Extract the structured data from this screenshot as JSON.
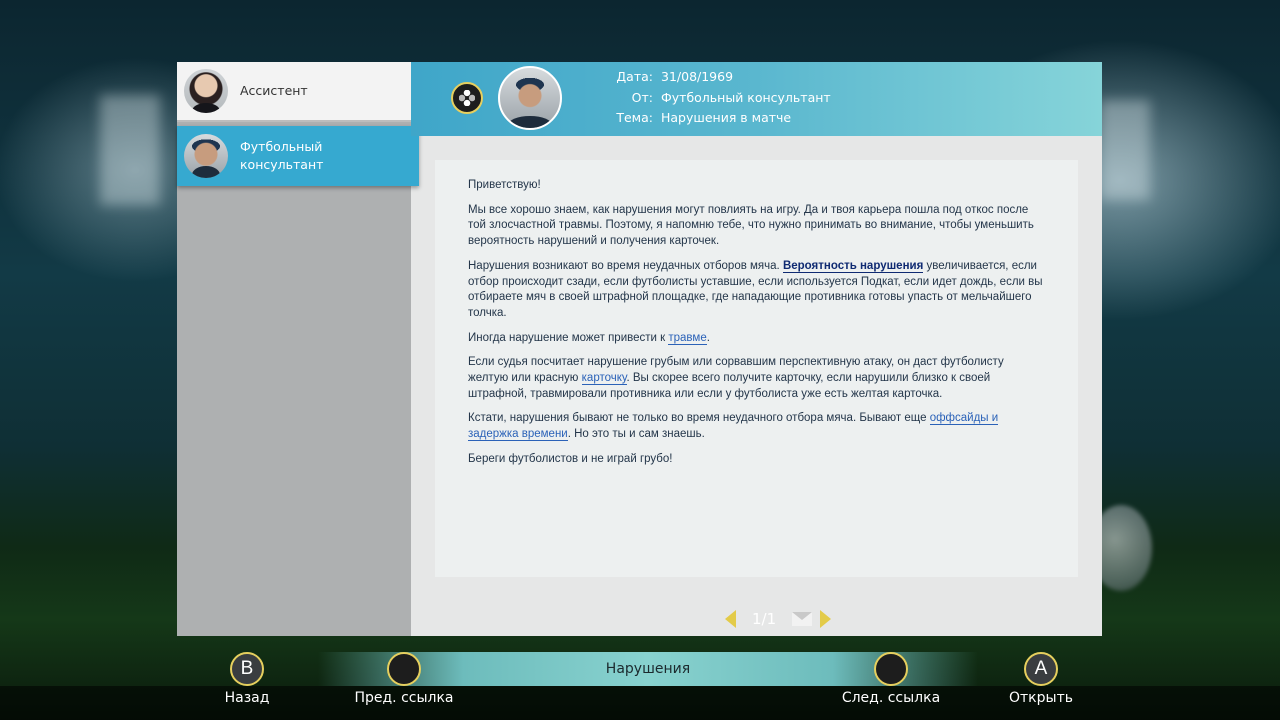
{
  "contacts": [
    {
      "name": "Ассистент",
      "selected": false
    },
    {
      "name": "Футбольный консультант",
      "selected": true
    }
  ],
  "message": {
    "date_label": "Дата:",
    "date": "31/08/1969",
    "from_label": "От:",
    "from": "Футбольный консультант",
    "subject_label": "Тема:",
    "subject": "Нарушения в матче"
  },
  "body": {
    "p1": "Приветствую!",
    "p2": "Мы все хорошо знаем, как нарушения могут повлиять на игру. Да и твоя карьера пошла под откос после той злосчастной травмы. Поэтому, я напомню тебе, что нужно принимать во внимание, чтобы уменьшить вероятность нарушений и получения карточек.",
    "p3_a": "Нарушения возникают во время неудачных отборов мяча. ",
    "p3_link": "Вероятность нарушения",
    "p3_b": " увеличивается, если отбор происходит сзади, если футболисты уставшие, если используется Подкат, если идет дождь, если вы отбираете мяч в своей штрафной площадке, где нападающие противника готовы упасть от мельчайшего толчка.",
    "p4_a": "Иногда нарушение может привести к ",
    "p4_link": "травме",
    "p4_b": ".",
    "p5_a": "Если судья посчитает нарушение грубым или сорвавшим перспективную атаку, он даст футболисту желтую или красную ",
    "p5_link": "карточку",
    "p5_b": ". Вы скорее всего получите карточку, если нарушили близко к своей штрафной, травмировали противника или если у футболиста уже есть желтая карточка.",
    "p6_a": "Кстати, нарушения бывают не только во время неудачного отбора мяча. Бывают еще ",
    "p6_link": "оффсайды и задержка времени",
    "p6_b": ". Но это ты и сам знаешь.",
    "p7": "Береги футболистов и не играй грубо!"
  },
  "pager": {
    "text": "1/1"
  },
  "topic_title": "Нарушения",
  "hints": {
    "back_button": "B",
    "back_label": "Назад",
    "prev_label": "Пред. ссылка",
    "next_label": "След. ссылка",
    "open_button": "A",
    "open_label": "Открыть"
  },
  "colors": {
    "accent_blue": "#36a9d0",
    "header_gradient_end": "#86d4d9",
    "button_ring": "#e6cf5e",
    "link": "#2b62b8",
    "selected_link": "#0f2a72"
  }
}
